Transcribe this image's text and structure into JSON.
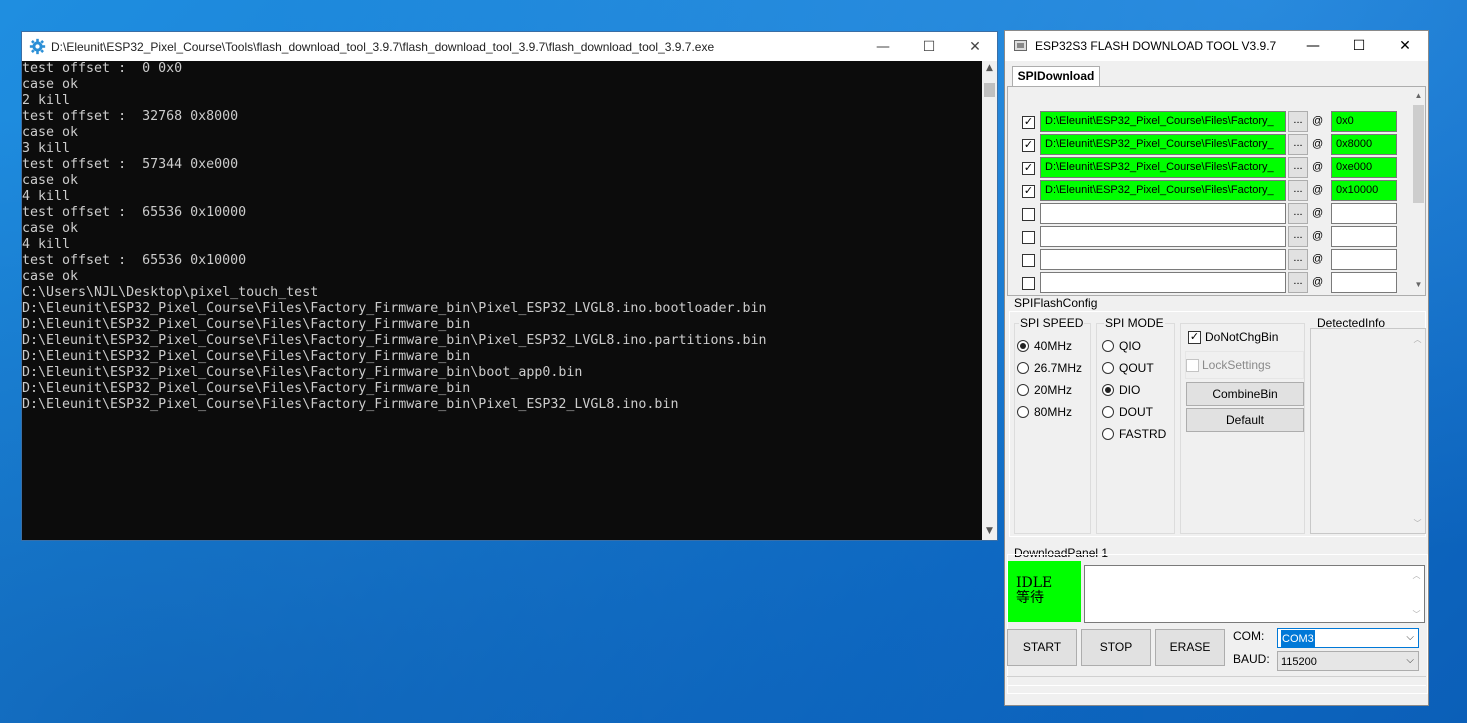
{
  "console": {
    "title": "D:\\Eleunit\\ESP32_Pixel_Course\\Tools\\flash_download_tool_3.9.7\\flash_download_tool_3.9.7\\flash_download_tool_3.9.7.exe",
    "lines": [
      "test offset :  0 0x0",
      "case ok",
      "2 kill",
      "test offset :  32768 0x8000",
      "case ok",
      "3 kill",
      "test offset :  57344 0xe000",
      "case ok",
      "4 kill",
      "test offset :  65536 0x10000",
      "case ok",
      "4 kill",
      "test offset :  65536 0x10000",
      "case ok",
      "C:\\Users\\NJL\\Desktop\\pixel_touch_test",
      "D:\\Eleunit\\ESP32_Pixel_Course\\Files\\Factory_Firmware_bin\\Pixel_ESP32_LVGL8.ino.bootloader.bin",
      "D:\\Eleunit\\ESP32_Pixel_Course\\Files\\Factory_Firmware_bin",
      "D:\\Eleunit\\ESP32_Pixel_Course\\Files\\Factory_Firmware_bin\\Pixel_ESP32_LVGL8.ino.partitions.bin",
      "D:\\Eleunit\\ESP32_Pixel_Course\\Files\\Factory_Firmware_bin",
      "D:\\Eleunit\\ESP32_Pixel_Course\\Files\\Factory_Firmware_bin\\boot_app0.bin",
      "D:\\Eleunit\\ESP32_Pixel_Course\\Files\\Factory_Firmware_bin",
      "D:\\Eleunit\\ESP32_Pixel_Course\\Files\\Factory_Firmware_bin\\Pixel_ESP32_LVGL8.ino.bin"
    ]
  },
  "window_controls": {
    "minimize": "—",
    "maximize": "☐",
    "close": "✕"
  },
  "tool": {
    "title": "ESP32S3 FLASH DOWNLOAD TOOL V3.9.7",
    "tab": "SPIDownload",
    "files": [
      {
        "checked": true,
        "path": "D:\\Eleunit\\ESP32_Pixel_Course\\Files\\Factory_",
        "addr": "0x0"
      },
      {
        "checked": true,
        "path": "D:\\Eleunit\\ESP32_Pixel_Course\\Files\\Factory_",
        "addr": "0x8000"
      },
      {
        "checked": true,
        "path": "D:\\Eleunit\\ESP32_Pixel_Course\\Files\\Factory_",
        "addr": "0xe000"
      },
      {
        "checked": true,
        "path": "D:\\Eleunit\\ESP32_Pixel_Course\\Files\\Factory_",
        "addr": "0x10000"
      },
      {
        "checked": false,
        "path": "",
        "addr": ""
      },
      {
        "checked": false,
        "path": "",
        "addr": ""
      },
      {
        "checked": false,
        "path": "",
        "addr": ""
      },
      {
        "checked": false,
        "path": "",
        "addr": ""
      }
    ],
    "browse_label": "...",
    "at_sign": "@",
    "spi_flash_config": "SPIFlashConfig",
    "spi_speed": {
      "label": "SPI SPEED",
      "options": [
        "40MHz",
        "26.7MHz",
        "20MHz",
        "80MHz"
      ],
      "selected": "40MHz"
    },
    "spi_mode": {
      "label": "SPI MODE",
      "options": [
        "QIO",
        "QOUT",
        "DIO",
        "DOUT",
        "FASTRD"
      ],
      "selected": "DIO"
    },
    "do_not_chg_bin": {
      "label": "DoNotChgBin",
      "checked": true
    },
    "lock_settings": {
      "label": "LockSettings",
      "checked": false
    },
    "combine_bin": "CombineBin",
    "default": "Default",
    "detected_info": "DetectedInfo",
    "download_panel": "DownloadPanel 1",
    "status": {
      "line1": "IDLE",
      "line2": "等待"
    },
    "start": "START",
    "stop": "STOP",
    "erase": "ERASE",
    "com_label": "COM:",
    "com_value": "COM3",
    "baud_label": "BAUD:",
    "baud_value": "115200"
  },
  "colors": {
    "green_fill": "#00ff00",
    "console_bg": "#0c0c0c",
    "console_text": "#cccccc",
    "accent_blue": "#0078d7"
  }
}
